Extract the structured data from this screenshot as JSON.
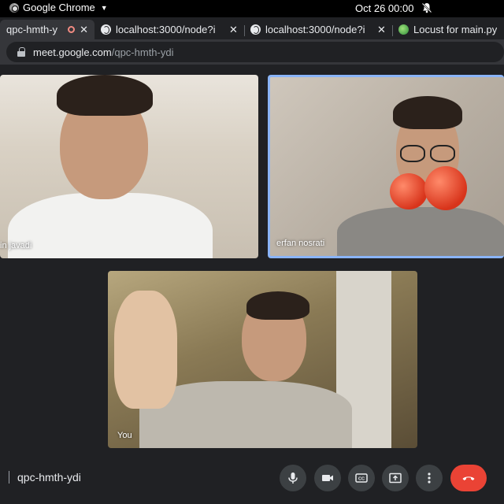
{
  "os": {
    "app_name": "Google Chrome",
    "clock": "Oct 26  00:00"
  },
  "tabs": [
    {
      "label": "qpc-hmth-y",
      "active": true
    },
    {
      "label": "localhost:3000/node?i",
      "active": false
    },
    {
      "label": "localhost:3000/node?i",
      "active": false
    },
    {
      "label": "Locust for main.py",
      "active": false
    }
  ],
  "address_bar": {
    "host": "meet.google.com",
    "path": "/qpc-hmth-ydi"
  },
  "participants": [
    {
      "name": "in javadi"
    },
    {
      "name": "erfan nosrati",
      "speaking": true
    },
    {
      "name": "You"
    }
  ],
  "meeting": {
    "code": "qpc-hmth-ydi"
  },
  "controls": {
    "icons": [
      "microphone-icon",
      "camera-icon",
      "captions-icon",
      "present-icon",
      "more-icon",
      "hang-up-icon"
    ],
    "end_color": "#ea4335",
    "accent_color": "#8ab4f8"
  }
}
